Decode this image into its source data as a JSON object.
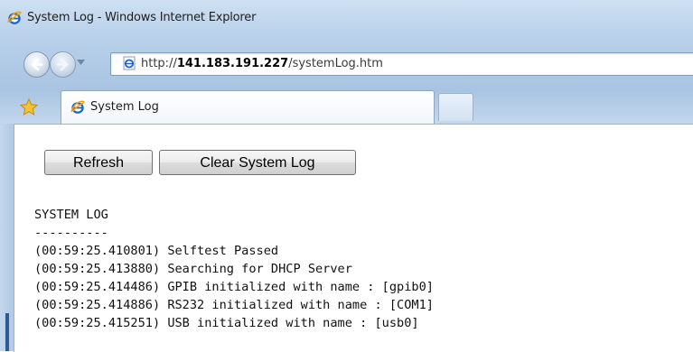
{
  "window": {
    "title": "System Log - Windows Internet Explorer"
  },
  "address_bar": {
    "prefix": "http://",
    "host": "141.183.191.227",
    "path": "/systemLog.htm"
  },
  "tabs": [
    {
      "label": "System Log",
      "active": true
    }
  ],
  "toolbar": {
    "refresh_label": "Refresh",
    "clear_label": "Clear System Log"
  },
  "log": {
    "heading": "SYSTEM LOG",
    "separator": "----------",
    "entries": [
      "(00:59:25.410801) Selftest Passed",
      "(00:59:25.413880) Searching for DHCP Server",
      "(00:59:25.414486) GPIB initialized with name : [gpib0]",
      "(00:59:25.414886) RS232 initialized with name : [COM1]",
      "(00:59:25.415251) USB initialized with name : [usb0]"
    ]
  },
  "icons": {
    "title_logo": "ie-logo-icon",
    "back": "back-arrow-icon",
    "forward": "forward-arrow-icon",
    "address_page": "ie-page-icon",
    "favorites": "star-icon",
    "tab_logo": "ie-logo-icon"
  }
}
